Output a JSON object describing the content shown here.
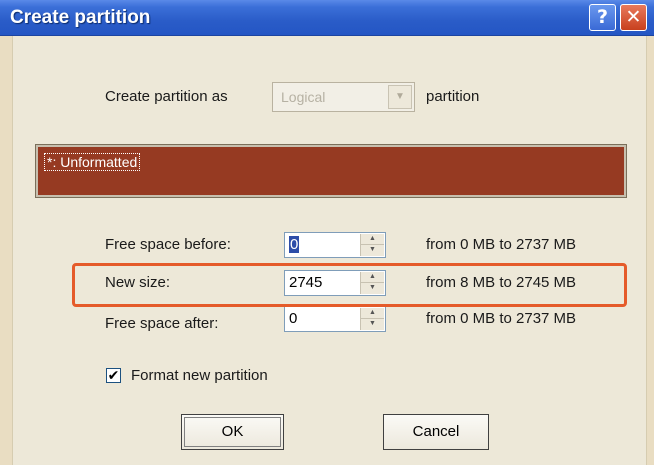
{
  "window": {
    "title": "Create partition",
    "help_glyph": "?",
    "close_glyph": "✕"
  },
  "partition_type": {
    "prefix_label": "Create partition as",
    "selected": "Logical",
    "suffix_label": "partition",
    "enabled": false
  },
  "partition_bar": {
    "label": "*: Unformatted",
    "color": "#963a22"
  },
  "free_before": {
    "label": "Free space before:",
    "value": "0",
    "range": "from 0  MB  to 2737  MB"
  },
  "new_size": {
    "label": "New size:",
    "value": "2745",
    "range": "from 8  MB  to 2745  MB",
    "highlight_color": "#e55b2a"
  },
  "free_after": {
    "label": "Free space after:",
    "value": "0",
    "range": "from 0  MB  to 2737  MB"
  },
  "format": {
    "label": "Format new partition",
    "checked": true,
    "check_glyph": "✔"
  },
  "buttons": {
    "ok": "OK",
    "cancel": "Cancel"
  },
  "spin_glyphs": {
    "up": "▲",
    "down": "▼",
    "dropdown": "▼"
  }
}
